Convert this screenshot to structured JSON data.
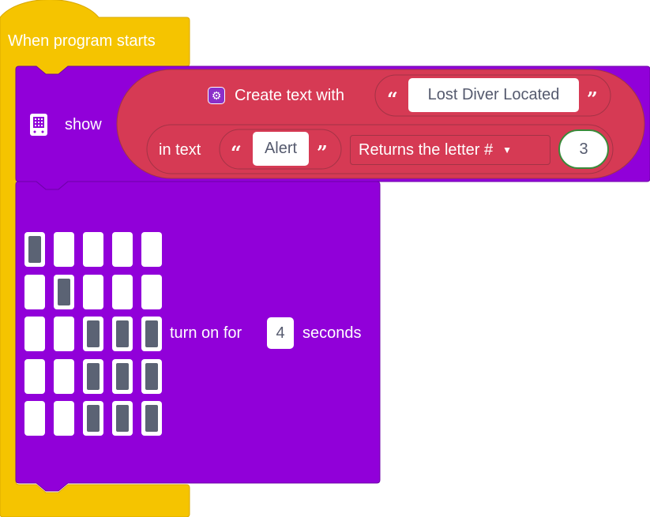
{
  "hat_block": {
    "label": "When program starts"
  },
  "show_block": {
    "label": "show",
    "icon": "microbit-device-icon",
    "create_text": {
      "label": "Create text with",
      "icon": "gear-icon",
      "text_value": "Lost Diver Located"
    },
    "letter_picker": {
      "prefix": "in text",
      "text_value": "Alert",
      "mode": "Returns the letter #",
      "index": "3"
    }
  },
  "led_block": {
    "matrix": [
      [
        1,
        0,
        0,
        0,
        0
      ],
      [
        0,
        1,
        0,
        0,
        0
      ],
      [
        0,
        0,
        1,
        1,
        1
      ],
      [
        0,
        0,
        1,
        1,
        1
      ],
      [
        0,
        0,
        1,
        1,
        1
      ]
    ],
    "prefix": "turn on for",
    "duration": "4",
    "suffix": "seconds"
  },
  "quote_open": "“",
  "quote_close": "”",
  "colors": {
    "hat_yellow": "#f5c400",
    "hat_border": "#d9a800",
    "block_purple": "#9100d9",
    "block_purple_border": "#6e00a8",
    "text_red": "#d63a54",
    "text_red_border": "#a33346",
    "led_on": "#5b6374"
  }
}
